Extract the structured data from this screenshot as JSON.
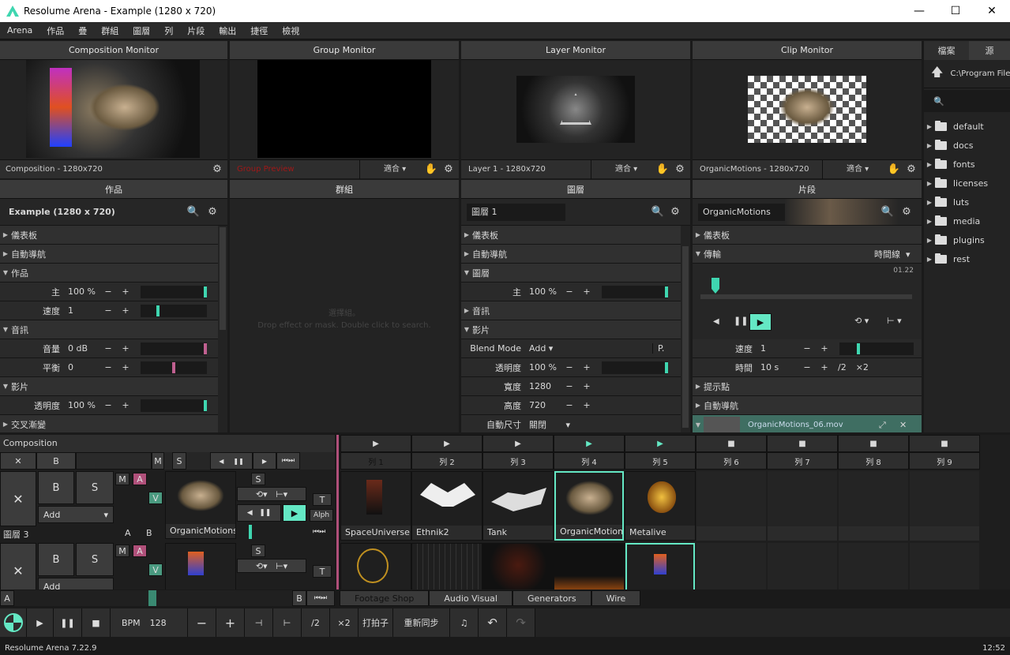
{
  "window": {
    "title": "Resolume Arena - Example (1280 x 720)",
    "min": "—",
    "max": "☐",
    "close": "✕"
  },
  "menu": [
    "Arena",
    "作品",
    "疊",
    "群組",
    "圖層",
    "列",
    "片段",
    "輸出",
    "捷徑",
    "檢視"
  ],
  "monitors": {
    "composition": {
      "title": "Composition Monitor",
      "footer": "Composition - 1280x720"
    },
    "group": {
      "title": "Group Monitor",
      "footer": "Group Preview",
      "fit": "適合"
    },
    "layer": {
      "title": "Layer Monitor",
      "footer": "Layer 1 - 1280x720",
      "fit": "適合"
    },
    "clip": {
      "title": "Clip Monitor",
      "footer": "OrganicMotions - 1280x720",
      "fit": "適合"
    }
  },
  "composition_panel": {
    "header": "作品",
    "name": "Example (1280 x 720)",
    "rows": {
      "dashboard": "儀表板",
      "autopilot": "自動導航",
      "comp": "作品",
      "master_label": "主",
      "master_val": "100 %",
      "speed_label": "速度",
      "speed_val": "1",
      "audio": "音訊",
      "volume_label": "音量",
      "volume_val": "0 dB",
      "pan_label": "平衡",
      "pan_val": "0",
      "video": "影片",
      "opacity_label": "透明度",
      "opacity_val": "100 %",
      "crossfade": "交叉漸變"
    },
    "master_level": 1.0,
    "speed_level": 0.25,
    "opacity_level": 1.0
  },
  "group_panel": {
    "header": "群組",
    "hint1": "選擇組。",
    "hint2": "Drop effect or mask. Double click to search."
  },
  "layer_panel": {
    "header": "圖層",
    "name": "圖層 1",
    "rows": {
      "dashboard": "儀表板",
      "autopilot": "自動導航",
      "layer": "圖層",
      "master_label": "主",
      "master_val": "100 %",
      "audio": "音訊",
      "video": "影片",
      "blend_label": "Blend Mode",
      "blend_val": "Add",
      "blend_p": "P.",
      "opacity_label": "透明度",
      "opacity_val": "100 %",
      "width_label": "寬度",
      "width_val": "1280",
      "height_label": "高度",
      "height_val": "720",
      "autosize_label": "自動尺寸",
      "autosize_val": "關閉"
    }
  },
  "clip_panel": {
    "header": "片段",
    "name": "OrganicMotions",
    "rows": {
      "dashboard": "儀表板",
      "transport": "傳輸",
      "timeline": "時間線",
      "time_readout": "01.22",
      "speed_label": "速度",
      "speed_val": "1",
      "duration_label": "時間",
      "duration_val": "10 s",
      "half": "/2",
      "double": "×2",
      "cuepoints": "提示點",
      "autopilot": "自動導航",
      "file": "OrganicMotions_06.mov",
      "file_sub": "OrganicMotions_06.mov"
    },
    "playhead": 0.07
  },
  "browser": {
    "tabs": [
      "檔案",
      "源"
    ],
    "path": "C:\\Program Files",
    "folders": [
      "default",
      "docs",
      "fonts",
      "licenses",
      "luts",
      "media",
      "plugins",
      "rest"
    ]
  },
  "deck": {
    "label": "Composition",
    "x": "✕",
    "b": "B",
    "m": "M",
    "s": "S",
    "layer3_name": "圖層 3",
    "add": "Add",
    "a": "A",
    "v": "V",
    "t": "T",
    "alpha": "Alph",
    "layer_clip": "OrganicMotions",
    "columns": [
      "列 1",
      "列 2",
      "列 3",
      "列 4",
      "列 5",
      "列 6",
      "列 7",
      "列 8",
      "列 9"
    ],
    "row1": [
      "SpaceUniverse",
      "Ethnik2",
      "Tank",
      "OrganicMotions",
      "Metalive",
      "",
      "",
      "",
      ""
    ],
    "deck_tabs": [
      "Footage Shop",
      "Audio Visual",
      "Generators",
      "Wire"
    ]
  },
  "bottom": {
    "bpm_label": "BPM",
    "bpm_val": "128",
    "minus": "−",
    "plus": "+",
    "half": "/2",
    "double": "×2",
    "tap": "打拍子",
    "resync": "重新同步"
  },
  "status": {
    "version": "Resolume Arena 7.22.9",
    "time": "12:52"
  },
  "colors": {
    "accent": "#64e8c4",
    "bg": "#1a1a1a"
  }
}
